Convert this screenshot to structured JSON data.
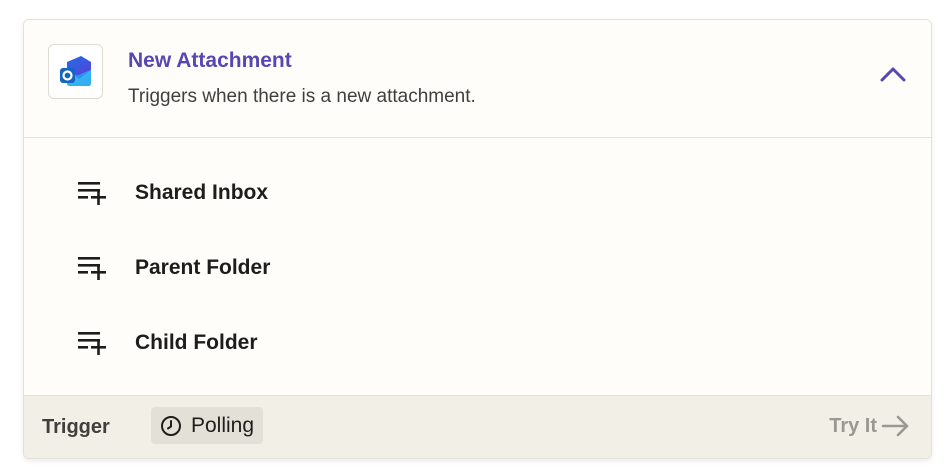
{
  "trigger": {
    "title": "New Attachment",
    "description": "Triggers when there is a new attachment.",
    "app_icon": "outlook-icon",
    "collapse_icon": "chevron-up-icon"
  },
  "fields": [
    {
      "label": "Shared Inbox",
      "icon": "add-field-icon"
    },
    {
      "label": "Parent Folder",
      "icon": "add-field-icon"
    },
    {
      "label": "Child Folder",
      "icon": "add-field-icon"
    }
  ],
  "footer": {
    "type_label": "Trigger",
    "mode_label": "Polling",
    "mode_icon": "clock-icon",
    "try_label": "Try It",
    "try_icon": "arrow-right-icon"
  },
  "colors": {
    "accent": "#5747b3",
    "footer_bg": "#f1efe6",
    "badge_bg": "#e3e1d7",
    "muted": "#9a9892"
  }
}
